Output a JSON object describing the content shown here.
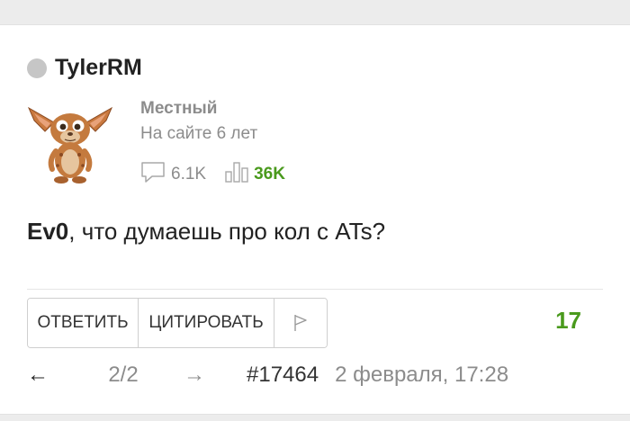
{
  "post": {
    "author": {
      "username": "TylerRM",
      "status_color": "#c6c6c6",
      "rank": "Местный",
      "member_since": "На сайте 6 лет",
      "comments_count": "6.1K",
      "rating": "36K",
      "avatar": "gremlin-avatar"
    },
    "message": {
      "mention": "Ev0",
      "text": ", что думаешь про кол с ATs?"
    },
    "actions": {
      "reply_label": "ОТВЕТИТЬ",
      "quote_label": "ЦИТИРОВАТЬ",
      "flag_icon": "flag-icon"
    },
    "score": "17",
    "pagination": {
      "prev_icon": "arrow-left-icon",
      "current": "2/2",
      "next_icon": "arrow-right-icon"
    },
    "post_id": "#17464",
    "date": "2 февраля, 17:28"
  },
  "colors": {
    "accent_green": "#4a9a1d",
    "muted_text": "#8c8c8c",
    "page_background": "#ececec"
  }
}
